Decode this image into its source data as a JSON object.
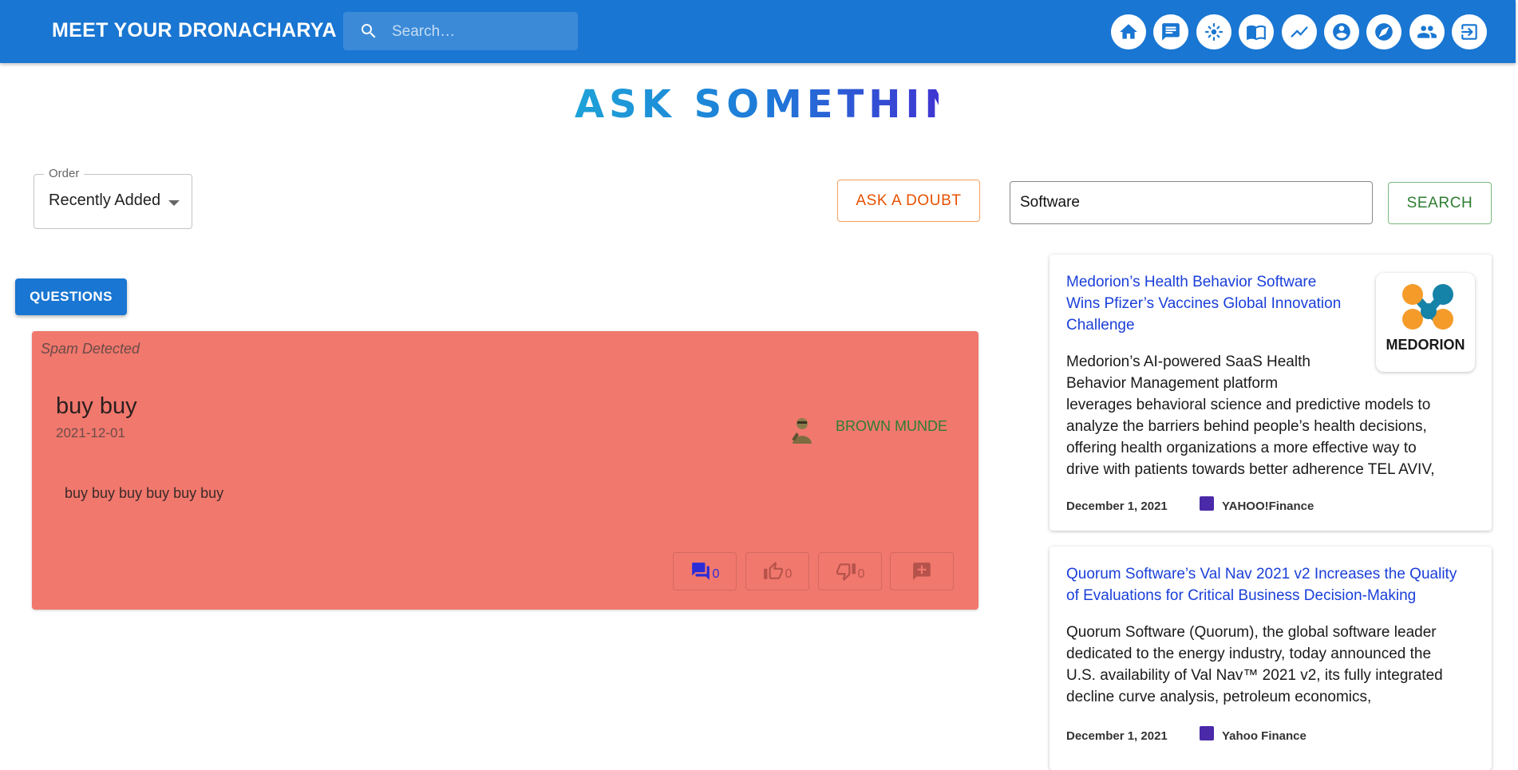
{
  "appbar": {
    "brand": "MEET YOUR DRONACHARYA",
    "search_placeholder": "Search…",
    "nav_icons": [
      "home-icon",
      "forum-icon",
      "explore-icon",
      "book-icon",
      "trending-icon",
      "account-icon",
      "compass-icon",
      "people-icon",
      "logout-icon"
    ],
    "color": "#1976d2"
  },
  "heading": "ASK SOMETHING",
  "order": {
    "label": "Order",
    "value": "Recently Added"
  },
  "ask_button": "ASK A DOUBT",
  "news_search": {
    "value": "Software",
    "button": "SEARCH"
  },
  "tabs": {
    "questions": "QUESTIONS"
  },
  "question": {
    "flag": "Spam Detected",
    "title": "buy buy",
    "date": "2021-12-01",
    "author": "BROWN MUNDE",
    "body": "buy buy buy buy buy buy",
    "answers": "0",
    "likes": "0",
    "dislikes": "0",
    "card_color": "#f1786d"
  },
  "news": [
    {
      "title_lines": [
        "Medorion’s Health Behavior Software",
        "Wins Pfizer’s Vaccines Global Innovation",
        "Challenge"
      ],
      "desc_lines": [
        "Medorion’s AI-powered SaaS Health",
        "Behavior Management platform",
        "leverages behavioral science and predictive models to",
        "analyze the barriers behind people’s health decisions,",
        "offering health organizations a more effective way to",
        "drive with patients towards better adherence TEL AVIV,"
      ],
      "date": "December 1, 2021",
      "source": "YAHOO!Finance",
      "logo_text": "MEDORION"
    },
    {
      "title_lines": [
        "Quorum Software’s Val Nav 2021 v2 Increases the Quality",
        "of Evaluations for Critical Business Decision-Making"
      ],
      "desc_lines": [
        "Quorum Software (Quorum), the global software leader",
        "dedicated to the energy industry, today announced the",
        "U.S. availability of Val Nav™ 2021 v2, its fully integrated",
        "decline curve analysis, petroleum economics,"
      ],
      "date": "December 1, 2021",
      "source": "Yahoo Finance"
    }
  ]
}
